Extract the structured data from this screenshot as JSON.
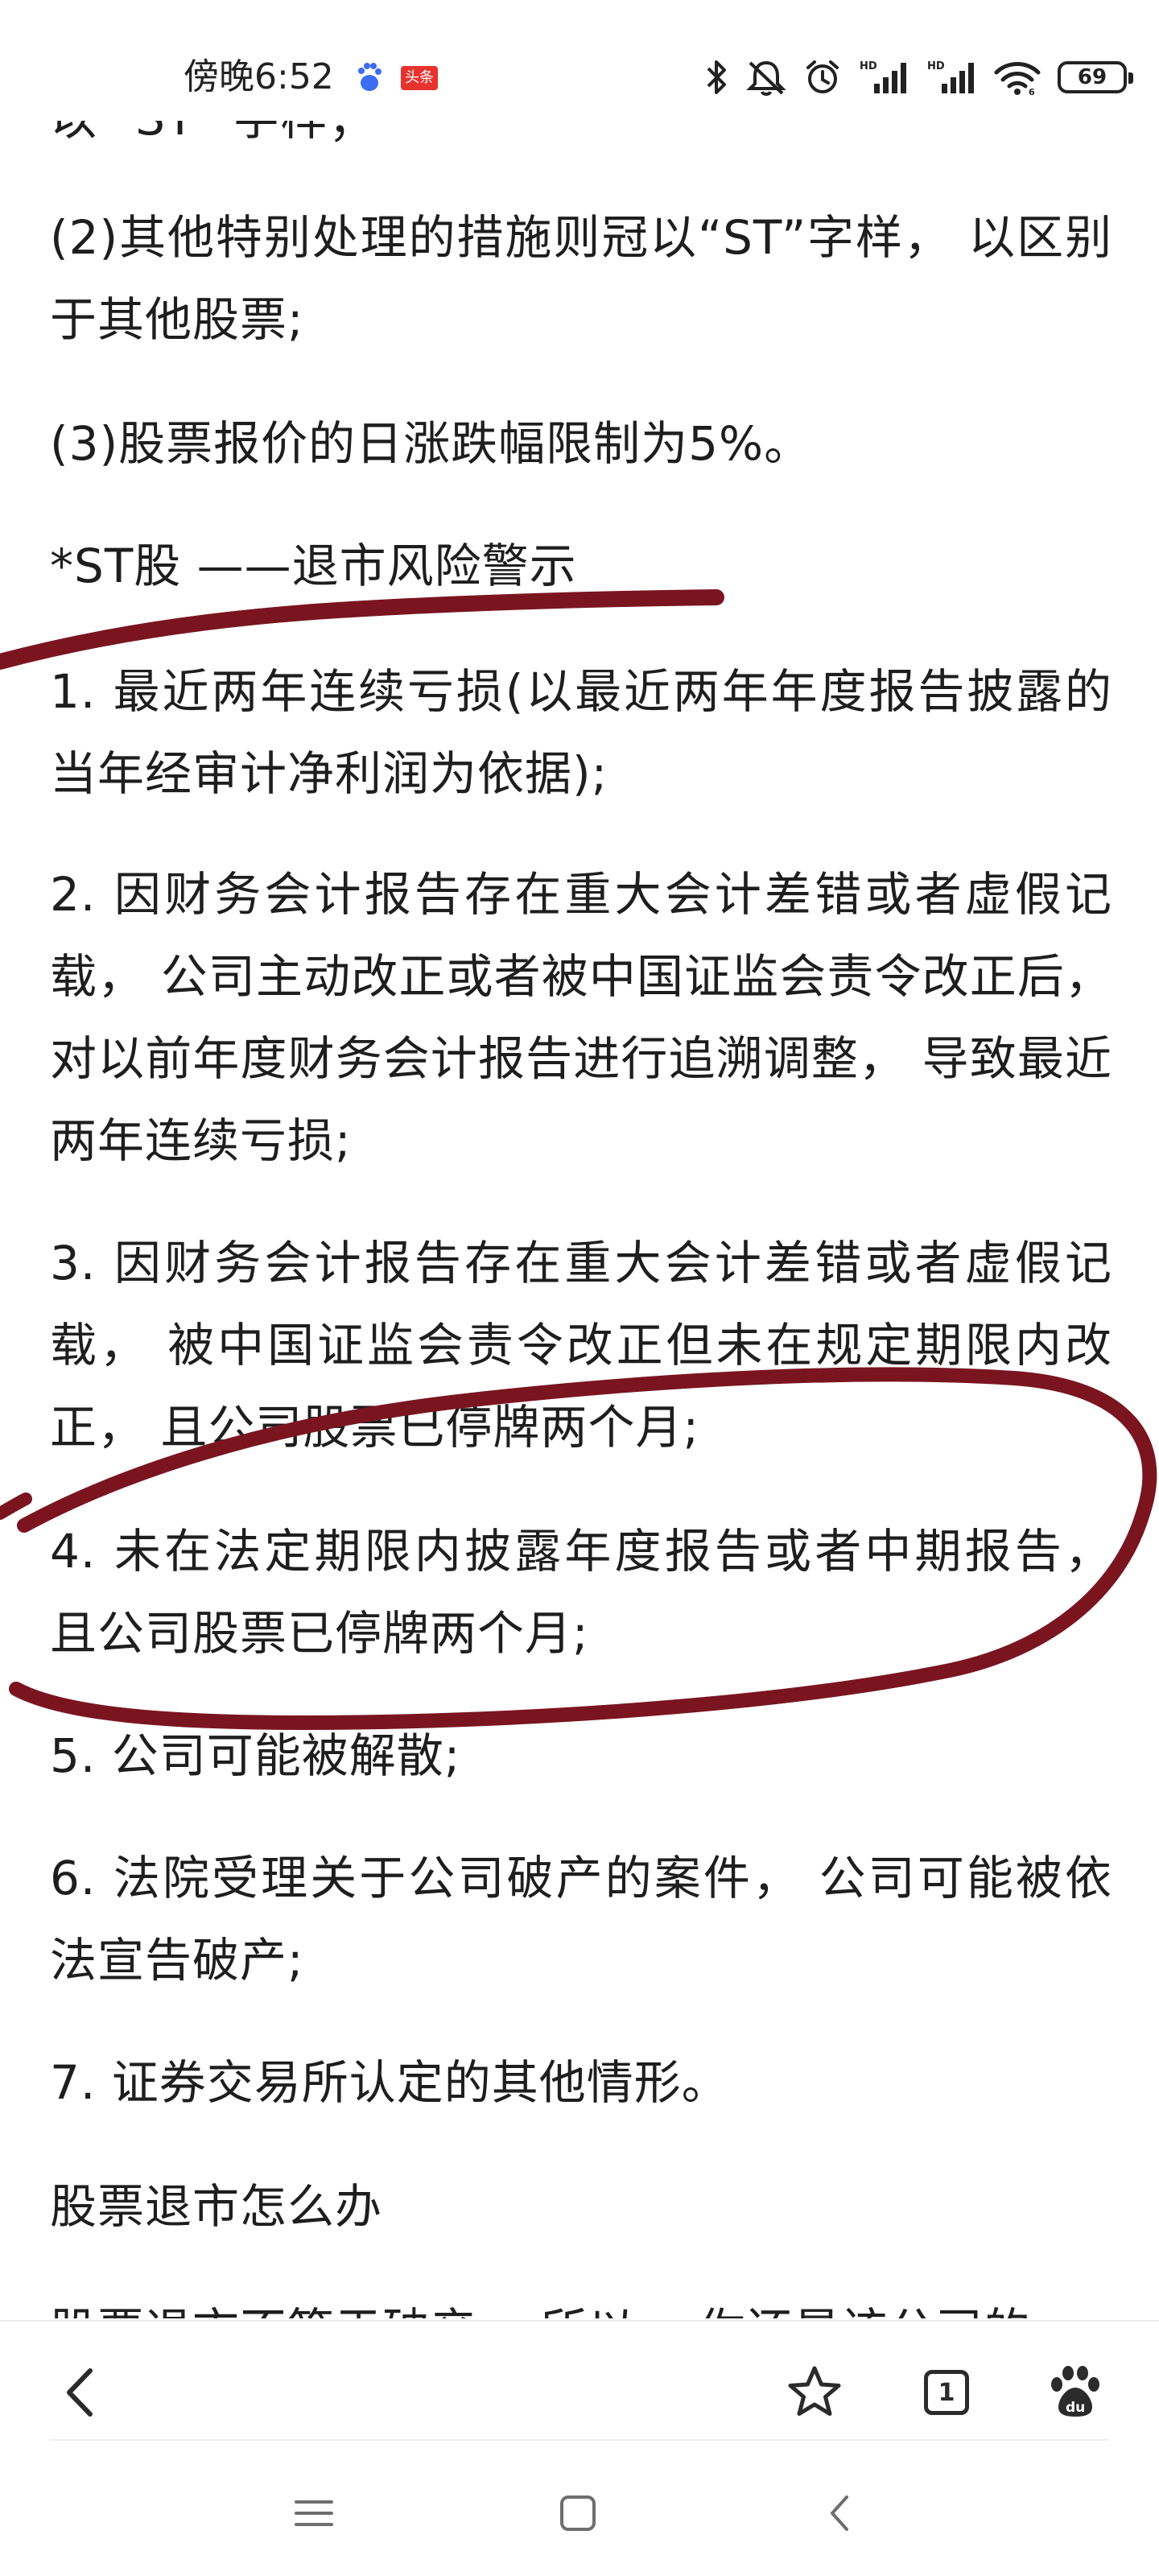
{
  "status_bar": {
    "time": "傍晚6:52",
    "news_badge": "头条",
    "battery_level": "69"
  },
  "article": {
    "cut_line": "以 \"ST\" 字样；",
    "paragraphs": [
      "(2)其他特别处理的措施则冠以“ST”字样， 以区别于其他股票;",
      "(3)股票报价的日涨跌幅限制为5%。",
      "*ST股 ——退市风险警示",
      "1. 最近两年连续亏损(以最近两年年度报告披露的当年经审计净利润为依据);",
      "2. 因财务会计报告存在重大会计差错或者虚假记 载， 公司主动改正或者被中国证监会责令改正后， 对以前年度财务会计报告进行追溯调整， 导致最近两年连续亏损;",
      "3. 因财务会计报告存在重大会计差错或者虚假记载， 被中国证监会责令改正但未在规定期限内改正， 且公司股票已停牌两个月;",
      "4. 未在法定期限内披露年度报告或者中期报告， 且公司股票已停牌两个月;",
      "5. 公司可能被解散;",
      "6. 法院受理关于公司破产的案件， 公司可能被依法宣告破产;",
      "7. 证券交易所认定的其他情形。",
      "股票退市怎么办",
      "股票退市不等于破产， 所以， 你还是该公司的"
    ],
    "annotation_color": "#7a1520"
  },
  "toolbar": {
    "tab_count": "1",
    "icons": [
      "back-arrow-icon",
      "star-icon",
      "tabs-icon",
      "baidu-paw-icon"
    ]
  },
  "nav_bar": {
    "icons": [
      "menu-icon",
      "home-square-icon",
      "back-chevron-icon"
    ]
  }
}
